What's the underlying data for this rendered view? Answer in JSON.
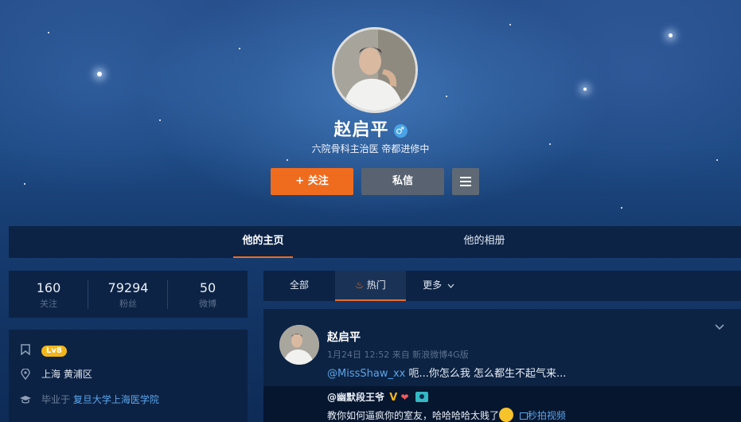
{
  "profile": {
    "name": "赵启平",
    "gender_icon": "♂",
    "bio": "六院骨科主治医 帝都进修中",
    "follow_label": "关注",
    "follow_plus": "+",
    "message_label": "私信"
  },
  "nav": {
    "tabs": [
      {
        "label": "他的主页",
        "active": true
      },
      {
        "label": "他的相册",
        "active": false
      }
    ]
  },
  "stats": [
    {
      "value": "160",
      "label": "关注"
    },
    {
      "value": "79294",
      "label": "粉丝"
    },
    {
      "value": "50",
      "label": "微博"
    }
  ],
  "info": {
    "level": "Lv8",
    "location": "上海 黄浦区",
    "school_prefix": "毕业于",
    "school": "复旦大学上海医学院"
  },
  "feed_tabs": {
    "all": "全部",
    "hot": "热门",
    "more": "更多"
  },
  "post": {
    "author": "赵启平",
    "meta": "1月24日 12:52 来自 新浪微博4G版",
    "mention": "@MissShaw_xx",
    "text": " 呃...你怎么我 怎么都生不起气来...",
    "repost": {
      "author": "@幽默段王爷",
      "v_badge": "V",
      "text": "教你如何逼疯你的室友，哈哈哈哈太贱了",
      "video_label": "秒拍视频"
    }
  },
  "colors": {
    "accent": "#ef6c1f",
    "link": "#5ba5ea",
    "panel": "#0c2242",
    "level_badge": "#f3b61a"
  }
}
